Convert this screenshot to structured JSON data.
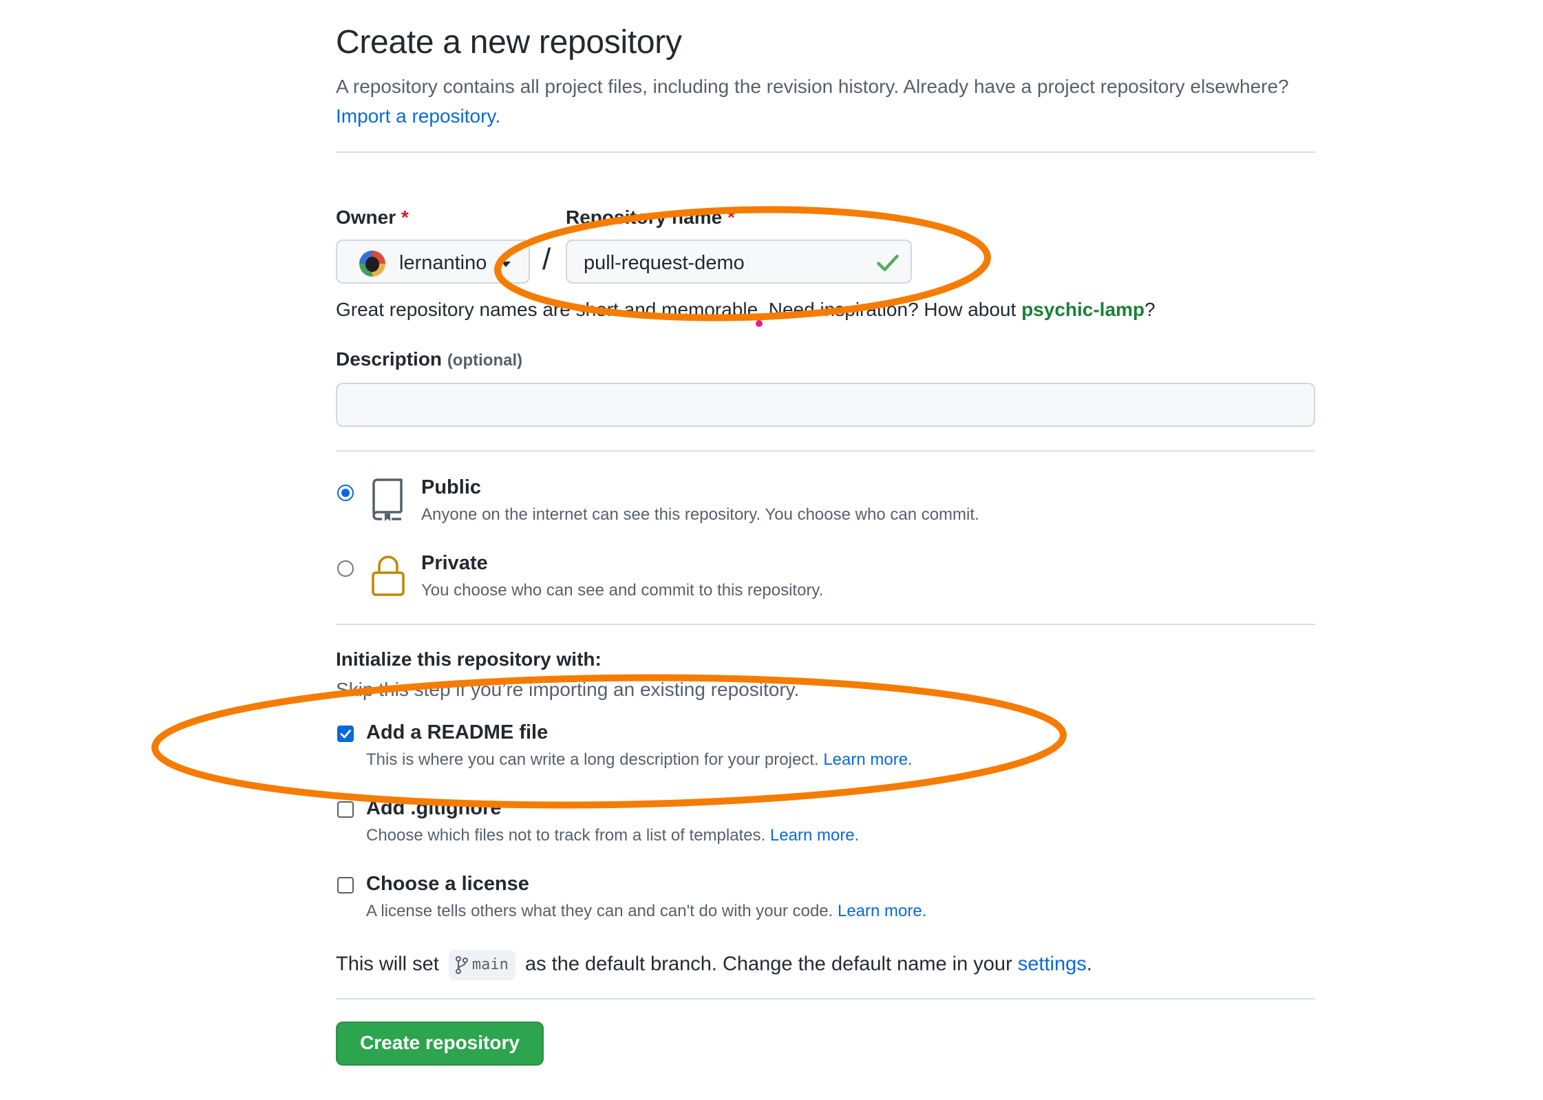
{
  "page": {
    "title": "Create a new repository",
    "subtitle_text": "A repository contains all project files, including the revision history. Already have a project repository elsewhere?",
    "import_link": "Import a repository."
  },
  "owner": {
    "label": "Owner",
    "required_mark": "*",
    "value": "lernantino"
  },
  "separator": "/",
  "repo_name": {
    "label": "Repository name",
    "required_mark": "*",
    "value": "pull-request-demo",
    "status": "valid"
  },
  "name_hint": {
    "text": "Great repository names are short and memorable. Need inspiration? How about",
    "suggestion": "psychic-lamp",
    "end": "?"
  },
  "description": {
    "label": "Description",
    "optional": "(optional)",
    "value": ""
  },
  "visibility": {
    "selected": "public",
    "options": [
      {
        "title": "Public",
        "desc": "Anyone on the internet can see this repository. You choose who can commit.",
        "icon": "repo-icon"
      },
      {
        "title": "Private",
        "desc": "You choose who can see and commit to this repository.",
        "icon": "lock-icon"
      }
    ]
  },
  "init": {
    "heading": "Initialize this repository with:",
    "sub": "Skip this step if you’re importing an existing repository.",
    "options": [
      {
        "title": "Add a README file",
        "desc": "This is where you can write a long description for your project.",
        "link": "Learn more.",
        "checked": true
      },
      {
        "title": "Add .gitignore",
        "desc": "Choose which files not to track from a list of templates.",
        "link": "Learn more.",
        "checked": false
      },
      {
        "title": "Choose a license",
        "desc": "A license tells others what they can and can't do with your code.",
        "link": "Learn more.",
        "checked": false
      }
    ]
  },
  "branch": {
    "prefix": "This will set",
    "name": "main",
    "middle": "as the default branch. Change the default name in your",
    "settings_link": "settings",
    "end": "."
  },
  "create_button": "Create repository",
  "colors": {
    "link": "#0969da",
    "create_button": "#2da44e",
    "annotation": "#f57c00",
    "suggestion": "#1a7f37",
    "required": "#cf222e"
  }
}
